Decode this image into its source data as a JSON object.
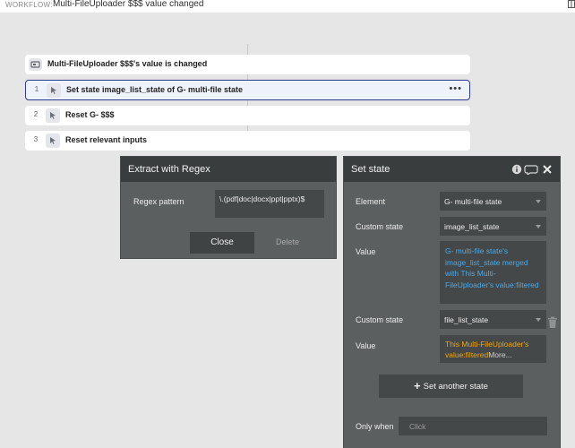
{
  "topbar": {
    "label": "WORKFLOW:",
    "title": "Multi-FileUploader $$$ value changed"
  },
  "workflow": {
    "event": "Multi-FileUploader $$$'s value is changed",
    "steps": [
      {
        "num": "1",
        "text": "Set state image_list_state of G- multi-file state",
        "menu": "•••"
      },
      {
        "num": "2",
        "text": "Reset G- $$$"
      },
      {
        "num": "3",
        "text": "Reset relevant inputs"
      }
    ]
  },
  "regex_panel": {
    "title": "Extract with Regex",
    "pattern_label": "Regex pattern",
    "pattern_value": "\\.(pdf|doc|docx|ppt|pptx)$",
    "close_label": "Close",
    "delete_label": "Delete"
  },
  "setstate_panel": {
    "title": "Set state",
    "element_label": "Element",
    "element_value": "G- multi-file state",
    "custom_state_label": "Custom state",
    "custom_state_value": "image_list_state",
    "value_label": "Value",
    "value_expr": "G- multi-file state's image_list_state merged with This Multi-FileUploader's value:filtered",
    "custom_state2_label": "Custom state",
    "custom_state2_value": "file_list_state",
    "value2_label": "Value",
    "value2_expr": "This Multi-FileUploader's value:filtered",
    "value2_more": "More...",
    "add_label": "Set another state",
    "only_when_label": "Only when",
    "only_when_placeholder": "Click"
  },
  "colors": {
    "expression_blue": "#4aa8e6",
    "expression_orange": "#f0a500",
    "selected_border": "#2b3a8f",
    "panel_bg": "#5c5f60",
    "panel_header": "#3a3d3e"
  },
  "icons": [
    "event-icon",
    "action-pointer-icon",
    "info-icon",
    "comment-icon",
    "close-icon",
    "trash-icon",
    "plus-icon",
    "chevron-down-icon"
  ]
}
